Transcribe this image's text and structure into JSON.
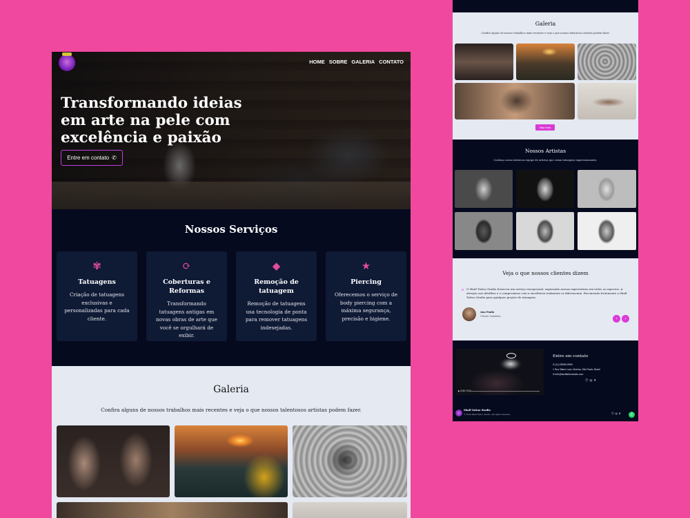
{
  "nav": {
    "items": [
      "HOME",
      "SOBRE",
      "GALERIA",
      "CONTATO"
    ]
  },
  "hero": {
    "title": "Transformando ideias em arte na pele com excelência e paixão",
    "cta_label": "Entre em contato"
  },
  "services": {
    "title": "Nossos Serviços",
    "items": [
      {
        "icon": "tattoo-icon",
        "title": "Tatuagens",
        "text": "Criação de tatuagens exclusivas e personalizadas para cada cliente."
      },
      {
        "icon": "refresh-icon",
        "title": "Coberturas e Reformas",
        "text": "Transformando tatuagens antigas em novas obras de arte que você se orgulhará de exibir."
      },
      {
        "icon": "eraser-icon",
        "title": "Remoção de tatuagem",
        "text": "Remoção de tatuagens usa tecnologia de ponta para remover tatuagens indesejadas."
      },
      {
        "icon": "star-icon",
        "title": "Piercing",
        "text": "Oferecemos o serviço de body piercing com a máxima segurança, precisão e higiene."
      }
    ]
  },
  "gallery": {
    "title": "Galeria",
    "subtitle": "Confira alguns de nossos trabalhos mais recentes e veja o que nossos talentosos artistas podem fazer.",
    "more_label": "Veja mais"
  },
  "artists": {
    "title": "Nossos Artistas",
    "subtitle": "Conheça nossa talentosa equipe de artistas que criam tatuagens impressionantes."
  },
  "testimonials": {
    "title": "Veja o que nossos clientes dizem",
    "quote": "O Skull Tattoo Studio forneceu um serviço excepcional, superando nossas expectativas em todos os aspectos. A atenção aos detalhes e o compromisso com a excelência realmente os diferenciam. Recomendo fortemente a Skull Tattoo Studio para qualquer projeto de tatuagem.",
    "author": "Ana Paula",
    "role": "Cliente Satisfeita"
  },
  "contact": {
    "title": "Entre em contato",
    "phone": "(11) 99999-9999",
    "address": "Rua Tattoo Love, Moema, São Paulo, Brasil",
    "email": "info@skulltattoostudio.com"
  },
  "video": {
    "time": "0:00 / 0:10"
  },
  "footer": {
    "brand": "Skull Tattoo Studio",
    "copyright": "© 2024 Skull Tattoo Studio. All rights reserved."
  },
  "colors": {
    "accent": "#d93ad6",
    "pink_bg": "#f0489e",
    "dark": "#060a1f",
    "card": "#0f1a35",
    "light": "#e4e9f2"
  }
}
